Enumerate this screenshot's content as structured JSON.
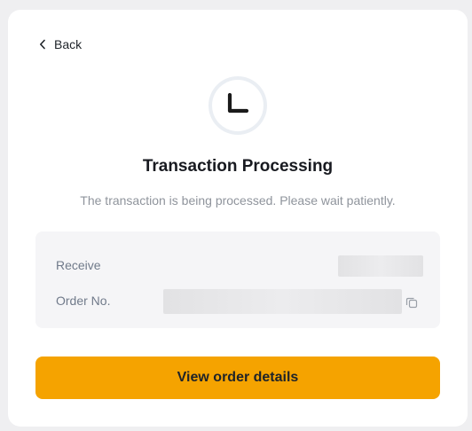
{
  "back": {
    "label": "Back",
    "icon": "chevron-left-icon"
  },
  "status": {
    "icon": "clock-icon",
    "title": "Transaction Processing",
    "message": "The transaction is being processed. Please wait patiently."
  },
  "details": {
    "receive_label": "Receive",
    "order_label": "Order No.",
    "copy_icon": "copy-icon"
  },
  "actions": {
    "primary_label": "View order details"
  },
  "colors": {
    "accent": "#F5A300",
    "text_primary": "#181A20",
    "text_secondary": "#8F949C",
    "panel_bg": "#F5F5F7"
  }
}
